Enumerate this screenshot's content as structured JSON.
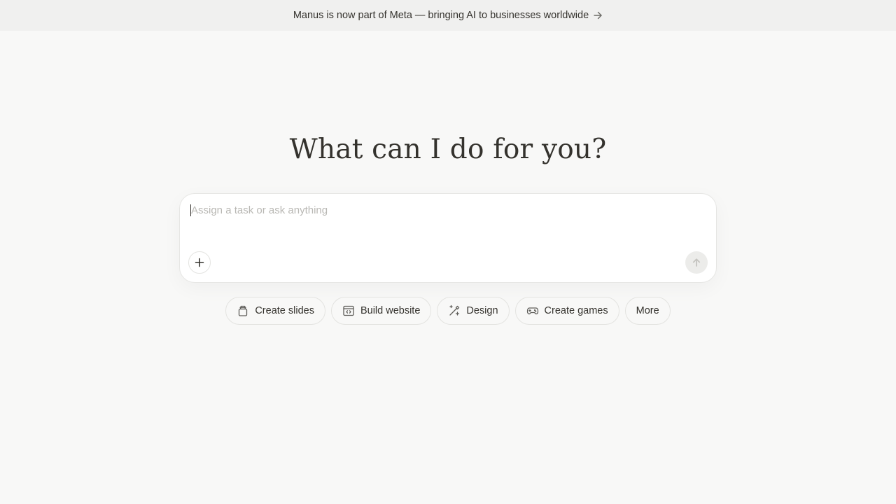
{
  "banner": {
    "text": "Manus is now part of Meta — bringing AI to businesses worldwide",
    "icon": "arrow-right-icon"
  },
  "headline": "What can I do for you?",
  "composer": {
    "placeholder": "Assign a task or ask anything",
    "value": "",
    "add_icon": "plus-icon",
    "send_icon": "arrow-up-icon"
  },
  "quick_actions": [
    {
      "label": "Create slides",
      "icon": "slides-icon"
    },
    {
      "label": "Build website",
      "icon": "website-icon"
    },
    {
      "label": "Design",
      "icon": "design-icon"
    },
    {
      "label": "Create games",
      "icon": "gamepad-icon"
    },
    {
      "label": "More",
      "icon": ""
    }
  ],
  "colors": {
    "background": "#f8f8f7",
    "banner_background": "#f0f0ef",
    "text": "#34322d",
    "placeholder": "#b9b8b4",
    "send_button_disabled": "#ececea"
  }
}
